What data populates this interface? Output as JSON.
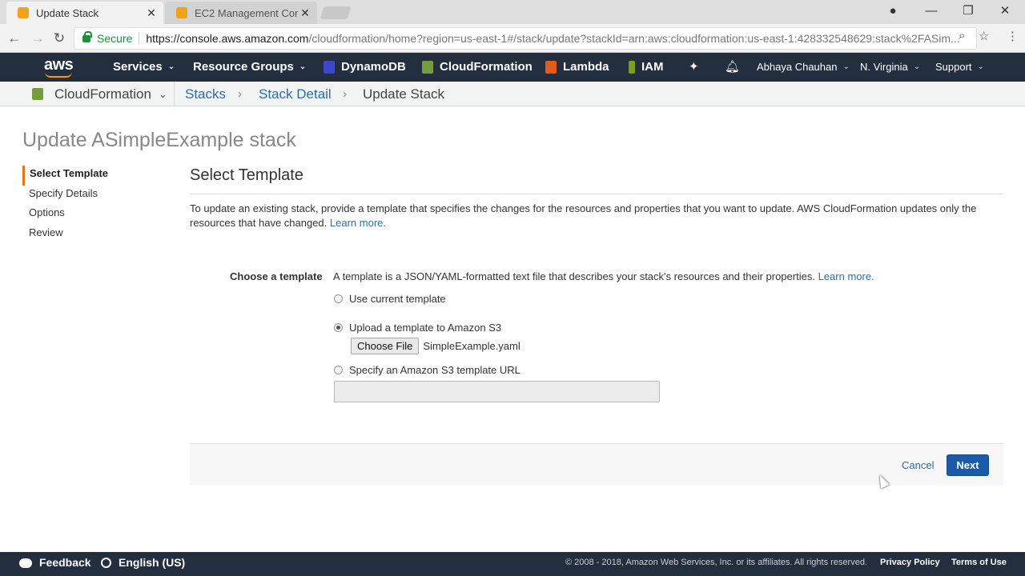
{
  "browser": {
    "tabs": [
      {
        "title": "Update Stack",
        "active": true
      },
      {
        "title": "EC2 Management Conso",
        "active": false
      }
    ],
    "secure_label": "Secure",
    "url_host": "https://console.aws.amazon.com",
    "url_rest": "/cloudformation/home?region=us-east-1#/stack/update?stackId=arn:aws:cloudformation:us-east-1:428332548629:stack%2FASim..."
  },
  "awsnav": {
    "logo": "aws",
    "services": "Services",
    "resource_groups": "Resource Groups",
    "shortcuts": [
      "DynamoDB",
      "CloudFormation",
      "Lambda",
      "IAM"
    ],
    "user": "Abhaya Chauhan",
    "region": "N. Virginia",
    "support": "Support"
  },
  "breadcrumb": {
    "service": "CloudFormation",
    "items": [
      "Stacks",
      "Stack Detail",
      "Update Stack"
    ]
  },
  "page": {
    "title": "Update ASimpleExample stack",
    "steps": [
      "Select Template",
      "Specify Details",
      "Options",
      "Review"
    ],
    "section_title": "Select Template",
    "intro": "To update an existing stack, provide a template that specifies the changes for the resources and properties that you want to update. AWS CloudFormation updates only the resources that have changed.",
    "learn_more": "Learn more.",
    "choose_label": "Choose a template",
    "choose_desc": "A template is a JSON/YAML-formatted text file that describes your stack's resources and their properties.",
    "options": {
      "current": "Use current template",
      "upload": "Upload a template to Amazon S3",
      "url": "Specify an Amazon S3 template URL"
    },
    "selected_option": "upload",
    "choose_file": "Choose File",
    "file_name": "SimpleExample.yaml",
    "url_value": "",
    "cancel": "Cancel",
    "next": "Next"
  },
  "footer": {
    "feedback": "Feedback",
    "language": "English (US)",
    "copyright": "© 2008 - 2018, Amazon Web Services, Inc. or its affiliates. All rights reserved.",
    "privacy": "Privacy Policy",
    "terms": "Terms of Use"
  }
}
